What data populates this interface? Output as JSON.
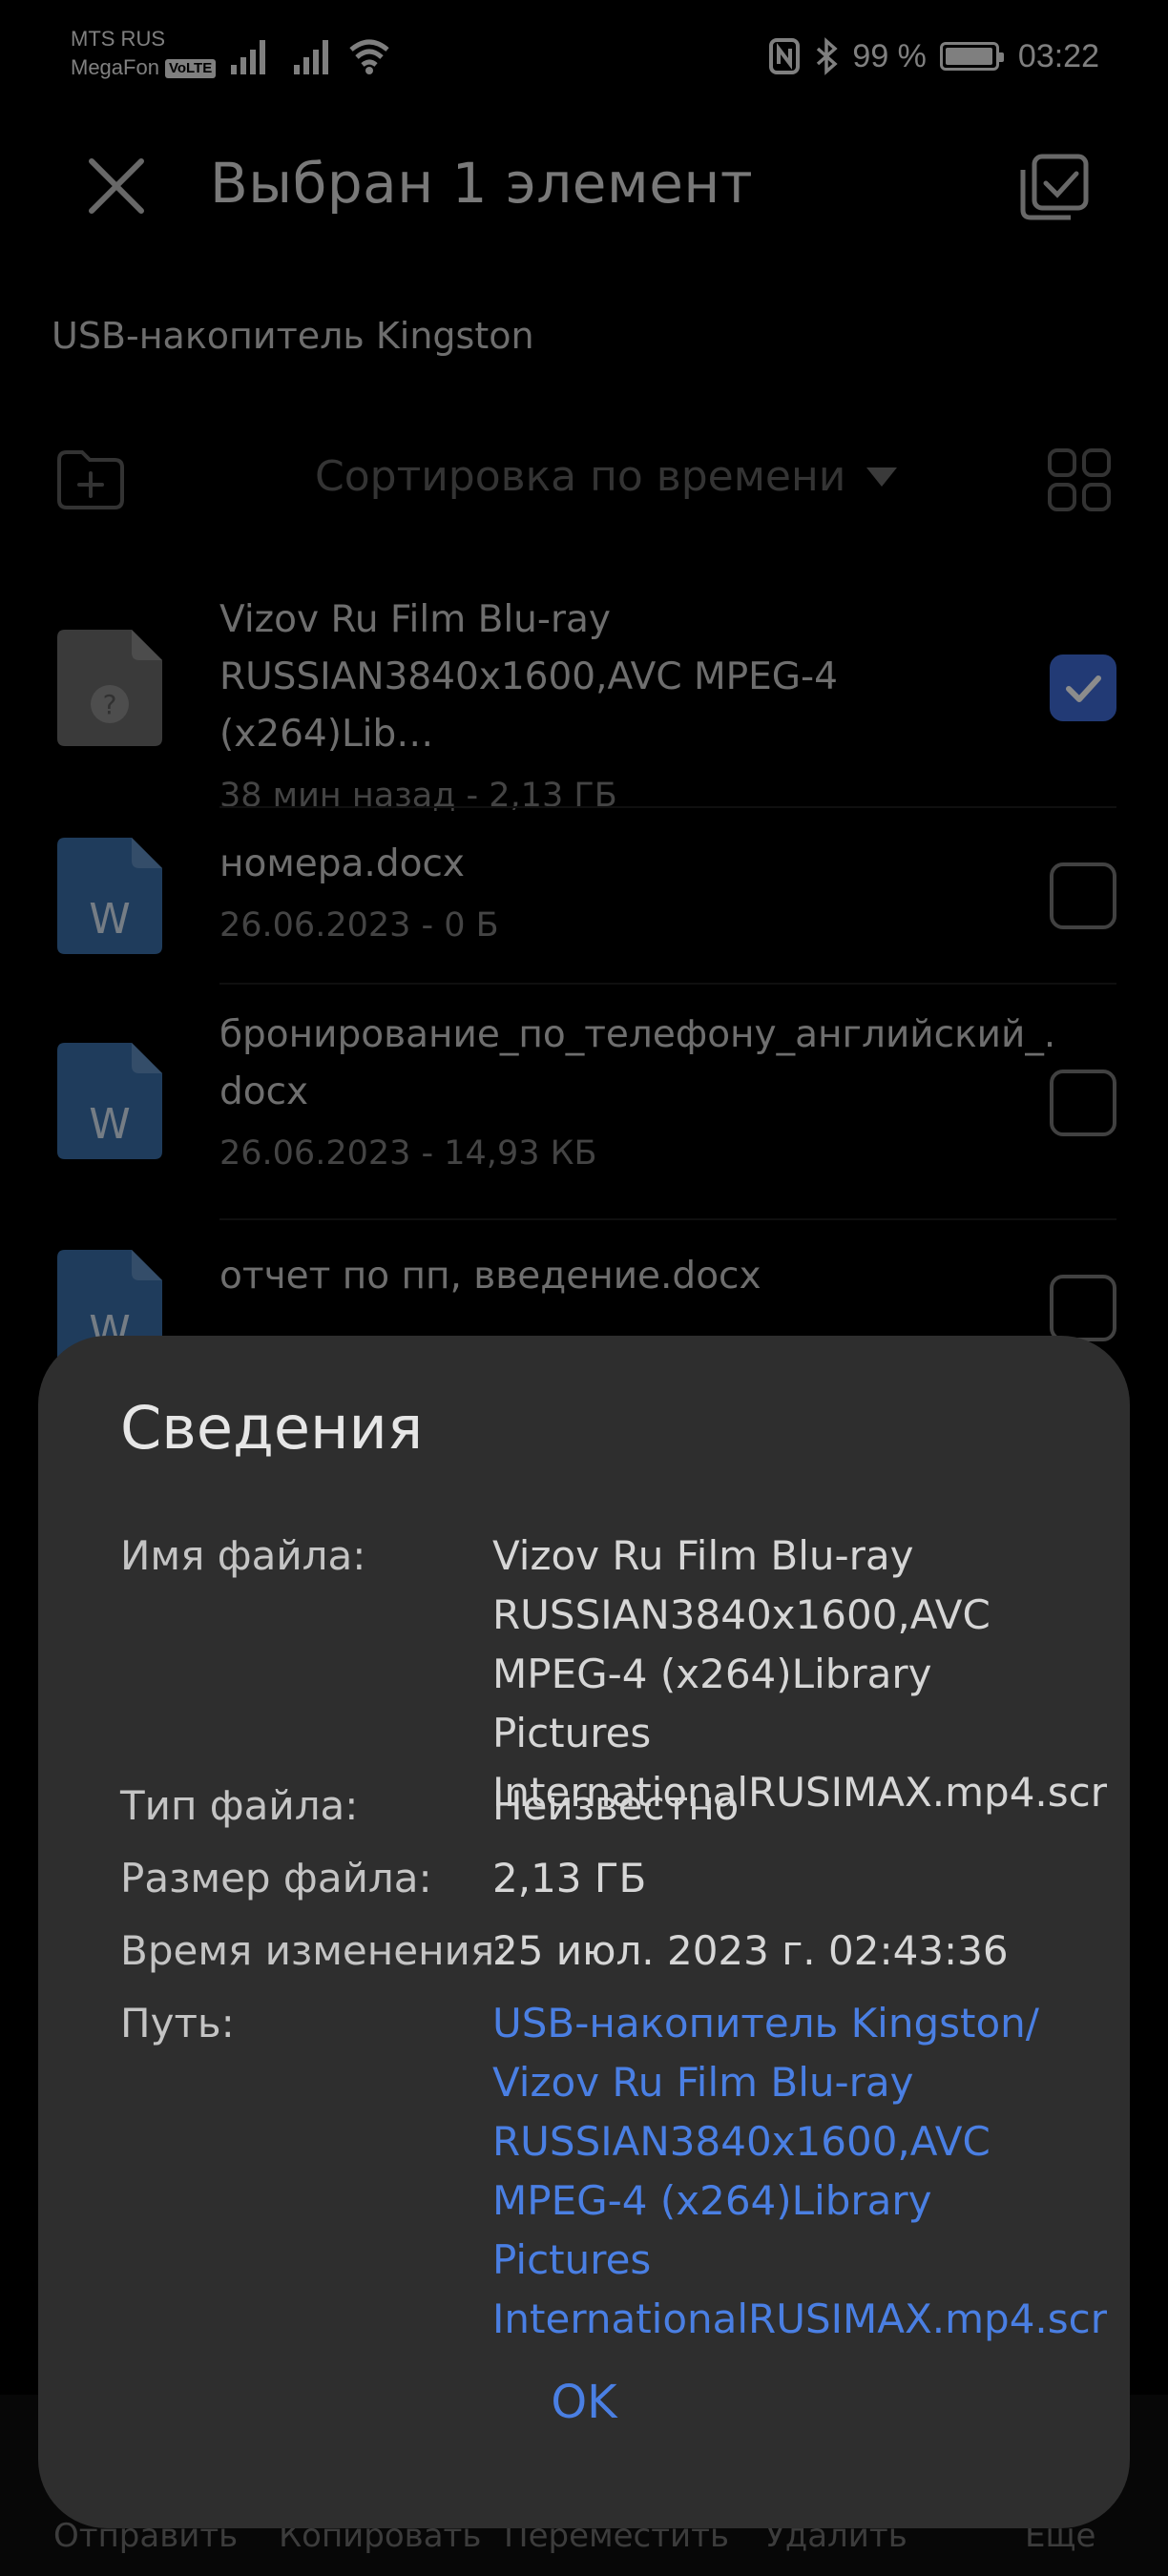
{
  "status_bar": {
    "carrier_1": "MTS RUS",
    "carrier_2": "MegaFon",
    "volte": "VoLTE",
    "battery": "99 %",
    "battery_level": 0.99,
    "time": "03:22"
  },
  "header": {
    "title": "Выбран 1 элемент"
  },
  "breadcrumb": "USB-накопитель Kingston",
  "toolbar": {
    "sort_label": "Сортировка по времени"
  },
  "files": [
    {
      "name_line1": "Vizov Ru Film Blu-ray",
      "name_line2": "RUSSIAN3840x1600,AVC MPEG-4 (x264)Lib…",
      "meta": "38 мин назад - 2,13 ГБ",
      "icon": "unknown-file-icon",
      "checked": true
    },
    {
      "name_line1": "номера.docx",
      "name_line2": "",
      "meta": "26.06.2023 - 0 Б",
      "icon": "word-doc-icon",
      "checked": false
    },
    {
      "name_line1": "бронирование_по_телефону_английский_.",
      "name_line2": "docx",
      "meta": "26.06.2023 - 14,93 КБ",
      "icon": "word-doc-icon",
      "checked": false
    },
    {
      "name_line1": "отчет по пп, введение.docx",
      "name_line2": "",
      "meta": "",
      "icon": "word-doc-icon",
      "checked": false
    }
  ],
  "bottom_bar": {
    "send": "Отправить",
    "copy": "Копировать",
    "move": "Переместить",
    "delete": "Удалить",
    "more": "Еще"
  },
  "dialog": {
    "title": "Сведения",
    "filename_label": "Имя файла:",
    "filename_value": "Vizov Ru Film Blu-ray\nRUSSIAN3840x1600,AVC\nMPEG-4 (x264)Library Pictures\nInternationalRUSIMAX.mp4.scr",
    "type_label": "Тип файла:",
    "type_value": "Неизвестно",
    "size_label": "Размер файла:",
    "size_value": "2,13 ГБ",
    "modified_label": "Время изменения:",
    "modified_value": "25 июл. 2023 г. 02:43:36",
    "path_label": "Путь:",
    "path_value": "USB-накопитель Kingston/\nVizov Ru Film Blu-ray\nRUSSIAN3840x1600,AVC\nMPEG-4 (x264)Library Pictures\nInternationalRUSIMAX.mp4.scr",
    "ok_label": "OK"
  },
  "colors": {
    "accent": "#4a7fe3",
    "checkbox": "#3f6bd6",
    "word_icon": "#3a6ea8",
    "dialog_bg": "#2e2e2e"
  }
}
